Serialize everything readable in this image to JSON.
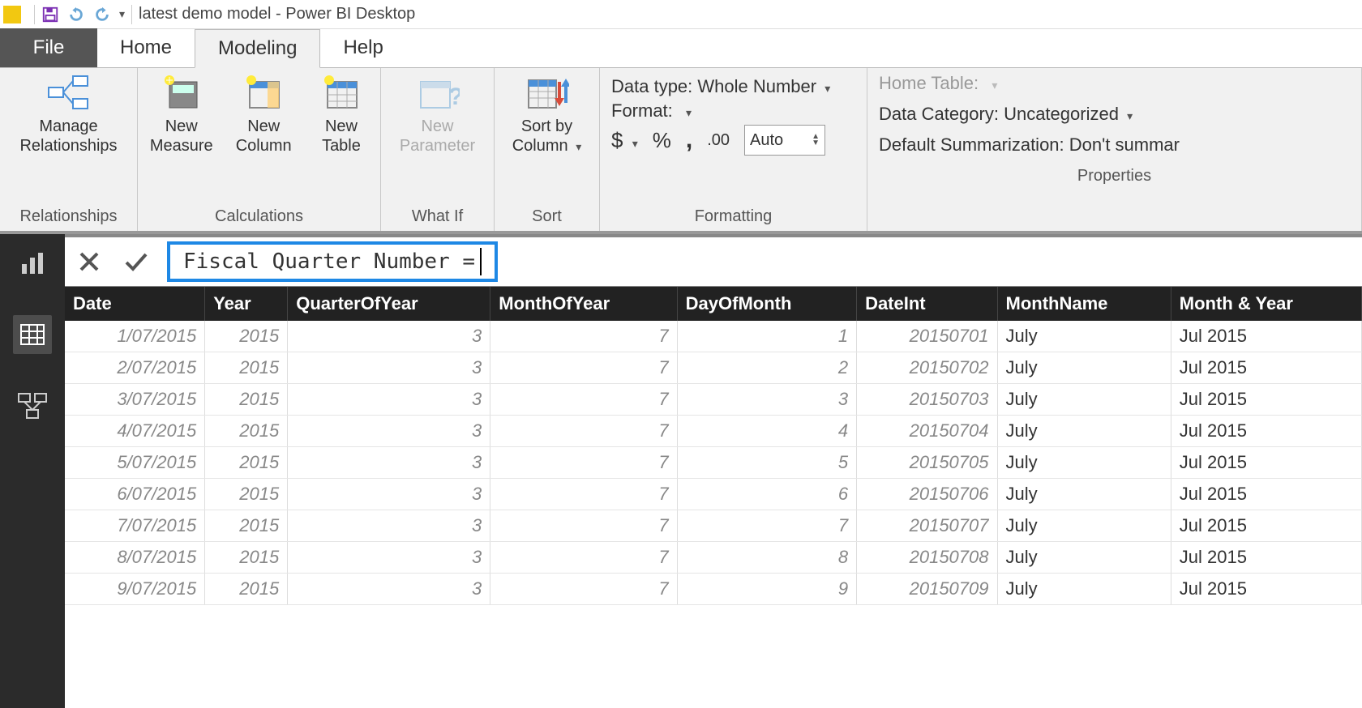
{
  "window": {
    "title": "latest demo model - Power BI Desktop"
  },
  "tabs": {
    "file": "File",
    "home": "Home",
    "modeling": "Modeling",
    "help": "Help"
  },
  "ribbon": {
    "relationships": {
      "manage": "Manage\nRelationships",
      "group": "Relationships"
    },
    "calculations": {
      "measure": "New\nMeasure",
      "column": "New\nColumn",
      "table": "New\nTable",
      "group": "Calculations"
    },
    "whatif": {
      "param": "New\nParameter",
      "group": "What If"
    },
    "sort": {
      "btn": "Sort by\nColumn",
      "group": "Sort"
    },
    "formatting": {
      "datatype_label": "Data type: Whole Number",
      "format_label": "Format:",
      "autobox": "Auto",
      "group": "Formatting"
    },
    "properties": {
      "home_table": "Home Table:",
      "data_category": "Data Category: Uncategorized",
      "default_summ": "Default Summarization: Don't summar",
      "group": "Properties"
    }
  },
  "formula": {
    "text": "Fiscal Quarter Number = "
  },
  "table": {
    "columns": [
      "Date",
      "Year",
      "QuarterOfYear",
      "MonthOfYear",
      "DayOfMonth",
      "DateInt",
      "MonthName",
      "Month & Year"
    ],
    "rows": [
      {
        "Date": "1/07/2015",
        "Year": "2015",
        "QuarterOfYear": "3",
        "MonthOfYear": "7",
        "DayOfMonth": "1",
        "DateInt": "20150701",
        "MonthName": "July",
        "MonthYear": "Jul 2015"
      },
      {
        "Date": "2/07/2015",
        "Year": "2015",
        "QuarterOfYear": "3",
        "MonthOfYear": "7",
        "DayOfMonth": "2",
        "DateInt": "20150702",
        "MonthName": "July",
        "MonthYear": "Jul 2015"
      },
      {
        "Date": "3/07/2015",
        "Year": "2015",
        "QuarterOfYear": "3",
        "MonthOfYear": "7",
        "DayOfMonth": "3",
        "DateInt": "20150703",
        "MonthName": "July",
        "MonthYear": "Jul 2015"
      },
      {
        "Date": "4/07/2015",
        "Year": "2015",
        "QuarterOfYear": "3",
        "MonthOfYear": "7",
        "DayOfMonth": "4",
        "DateInt": "20150704",
        "MonthName": "July",
        "MonthYear": "Jul 2015"
      },
      {
        "Date": "5/07/2015",
        "Year": "2015",
        "QuarterOfYear": "3",
        "MonthOfYear": "7",
        "DayOfMonth": "5",
        "DateInt": "20150705",
        "MonthName": "July",
        "MonthYear": "Jul 2015"
      },
      {
        "Date": "6/07/2015",
        "Year": "2015",
        "QuarterOfYear": "3",
        "MonthOfYear": "7",
        "DayOfMonth": "6",
        "DateInt": "20150706",
        "MonthName": "July",
        "MonthYear": "Jul 2015"
      },
      {
        "Date": "7/07/2015",
        "Year": "2015",
        "QuarterOfYear": "3",
        "MonthOfYear": "7",
        "DayOfMonth": "7",
        "DateInt": "20150707",
        "MonthName": "July",
        "MonthYear": "Jul 2015"
      },
      {
        "Date": "8/07/2015",
        "Year": "2015",
        "QuarterOfYear": "3",
        "MonthOfYear": "7",
        "DayOfMonth": "8",
        "DateInt": "20150708",
        "MonthName": "July",
        "MonthYear": "Jul 2015"
      },
      {
        "Date": "9/07/2015",
        "Year": "2015",
        "QuarterOfYear": "3",
        "MonthOfYear": "7",
        "DayOfMonth": "9",
        "DateInt": "20150709",
        "MonthName": "July",
        "MonthYear": "Jul 2015"
      }
    ]
  }
}
